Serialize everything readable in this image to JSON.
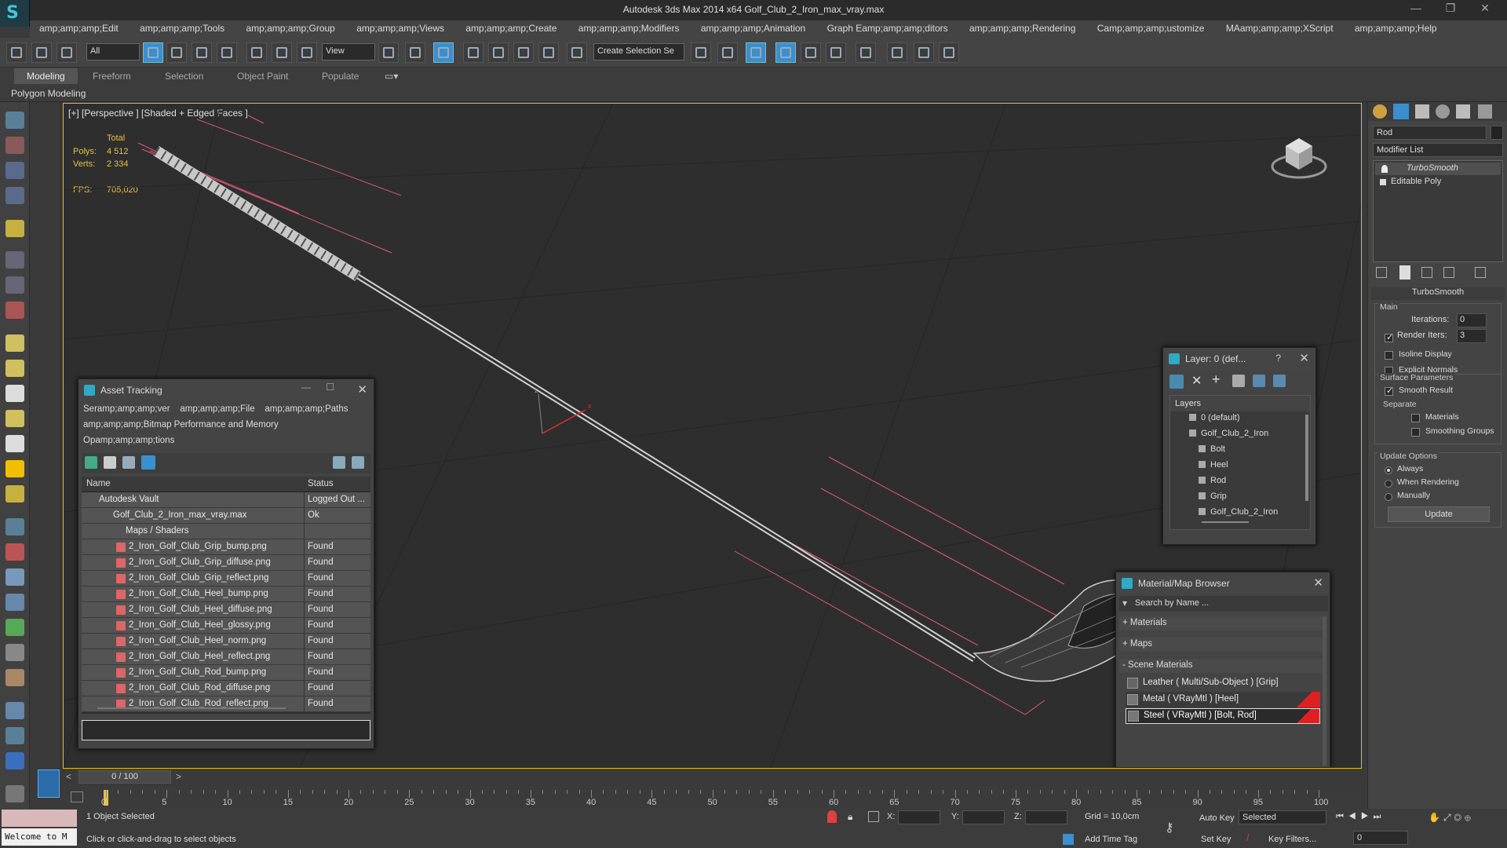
{
  "titlebar": {
    "title": "Autodesk 3ds Max  2014 x64     Golf_Club_2_Iron_max_vray.max",
    "min": "—",
    "max": "❐",
    "close": "✕"
  },
  "menu": [
    "amp;amp;amp;Edit",
    "amp;amp;amp;Tools",
    "amp;amp;amp;Group",
    "amp;amp;amp;Views",
    "amp;amp;amp;Create",
    "amp;amp;amp;Modifiers",
    "amp;amp;amp;Animation",
    "Graph Eamp;amp;amp;ditors",
    "amp;amp;amp;Rendering",
    "Camp;amp;amp;ustomize",
    "MAamp;amp;amp;XScript",
    "amp;amp;amp;Help"
  ],
  "toolbar": {
    "filter": "All",
    "refcoord": "View",
    "selset": "Create Selection Se"
  },
  "ribbon": {
    "tabs": [
      "Modeling",
      "Freeform",
      "Selection",
      "Object Paint",
      "Populate"
    ],
    "sub": "Polygon Modeling"
  },
  "viewport": {
    "label": "[+] [Perspective ] [Shaded + Edged Faces ]",
    "stats": {
      "total": "Total",
      "polys_label": "Polys:",
      "polys": "4 512",
      "verts_label": "Verts:",
      "verts": "2 334",
      "fps_label": "FPS:",
      "fps": "705,020"
    }
  },
  "asset": {
    "title": "Asset Tracking",
    "menu1": [
      "Seramp;amp;amp;ver",
      "amp;amp;amp;File",
      "amp;amp;amp;Paths"
    ],
    "menu2": "amp;amp;amp;Bitmap Performance and Memory",
    "menu3": "Opamp;amp;amp;tions",
    "col_name": "Name",
    "col_status": "Status",
    "rows": [
      {
        "name": "Autodesk Vault",
        "status": "Logged Out ..."
      },
      {
        "name": "Golf_Club_2_Iron_max_vray.max",
        "status": "Ok"
      },
      {
        "name": "Maps / Shaders",
        "status": ""
      },
      {
        "name": "2_Iron_Golf_Club_Grip_bump.png",
        "status": "Found"
      },
      {
        "name": "2_Iron_Golf_Club_Grip_diffuse.png",
        "status": "Found"
      },
      {
        "name": "2_Iron_Golf_Club_Grip_reflect.png",
        "status": "Found"
      },
      {
        "name": "2_Iron_Golf_Club_Heel_bump.png",
        "status": "Found"
      },
      {
        "name": "2_Iron_Golf_Club_Heel_diffuse.png",
        "status": "Found"
      },
      {
        "name": "2_Iron_Golf_Club_Heel_glossy.png",
        "status": "Found"
      },
      {
        "name": "2_Iron_Golf_Club_Heel_norm.png",
        "status": "Found"
      },
      {
        "name": "2_Iron_Golf_Club_Heel_reflect.png",
        "status": "Found"
      },
      {
        "name": "2_Iron_Golf_Club_Rod_bump.png",
        "status": "Found"
      },
      {
        "name": "2_Iron_Golf_Club_Rod_diffuse.png",
        "status": "Found"
      },
      {
        "name": "2_Iron_Golf_Club_Rod_reflect.png",
        "status": "Found"
      }
    ]
  },
  "layer": {
    "title": "Layer: 0 (def...",
    "help": "?",
    "header": "Layers",
    "items": [
      "0 (default)",
      "Golf_Club_2_Iron",
      "Bolt",
      "Heel",
      "Rod",
      "Grip",
      "Golf_Club_2_Iron"
    ]
  },
  "matbrowser": {
    "title": "Material/Map Browser",
    "search": "Search by Name ...",
    "groups": [
      "+ Materials",
      "+ Maps",
      "- Scene Materials"
    ],
    "materials": [
      "Leather  ( Multi/Sub-Object ) [Grip]",
      "Metal  ( VRayMtl ) [Heel]",
      "Steel  ( VRayMtl ) [Bolt, Rod]"
    ]
  },
  "modify": {
    "object_name": "Rod",
    "modifier_list": "Modifier List",
    "stack": [
      "TurboSmooth",
      "Editable Poly"
    ],
    "rollout": "TurboSmooth",
    "main": "Main",
    "iterations_label": "Iterations:",
    "iterations": "0",
    "render_iters_label": "Render Iters:",
    "render_iters": "3",
    "isoline": "Isoline Display",
    "explicit": "Explicit Normals",
    "surface": "Surface Parameters",
    "smooth": "Smooth Result",
    "separate": "Separate",
    "materials": "Materials",
    "smoothing": "Smoothing Groups",
    "update_opts": "Update Options",
    "always": "Always",
    "when_rendering": "When Rendering",
    "manually": "Manually",
    "update_btn": "Update"
  },
  "timeline": {
    "frame": "0 / 100",
    "ticks": [
      "0",
      "5",
      "10",
      "15",
      "20",
      "25",
      "30",
      "35",
      "40",
      "45",
      "50",
      "55",
      "60",
      "65",
      "70",
      "75",
      "80",
      "85",
      "90",
      "95",
      "100"
    ]
  },
  "status": {
    "welcome": "Welcome to M",
    "selected": "1 Object Selected",
    "prompt": "Click or click-and-drag to select objects",
    "x": "X:",
    "y": "Y:",
    "z": "Z:",
    "grid": "Grid = 10,0cm",
    "autokey": "Auto Key",
    "autokey_sel": "Selected",
    "setkey": "Set Key",
    "keyfilters": "Key Filters...",
    "addtimetag": "Add Time Tag",
    "frame_field": "0"
  },
  "colors": {
    "accent": "#3a8fcf",
    "viewport_border": "#f0c000",
    "material_red": "#e02020"
  }
}
